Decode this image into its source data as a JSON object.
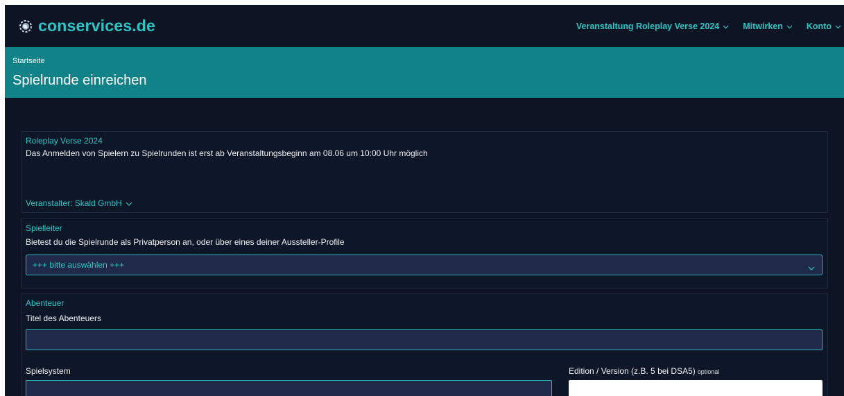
{
  "brand": {
    "name": "conservices.de",
    "logo_icon": "globe-gear-icon"
  },
  "nav": {
    "items": [
      {
        "label": "Veranstaltung Roleplay Verse 2024"
      },
      {
        "label": "Mitwirken"
      },
      {
        "label": "Konto"
      }
    ]
  },
  "hero": {
    "breadcrumb": "Startseite",
    "title": "Spielrunde einreichen"
  },
  "event": {
    "title": "Roleplay Verse 2024",
    "notice": "Das Anmelden von Spielern zu Spielrunden ist erst ab Veranstaltungsbeginn am 08.06 um 10:00 Uhr möglich",
    "organizer": "Veranstalter: Skald GmbH"
  },
  "gm": {
    "title": "Spielleiter",
    "question": "Bietest du die Spielrunde als Privatperson an, oder über eines deiner Aussteller-Profile",
    "select_value": "+++ bitte auswählen +++"
  },
  "adventure": {
    "title": "Abenteuer",
    "title_label": "Titel des Abenteuers",
    "system_label": "Spielsystem",
    "edition_label": "Edition / Version (z.B. 5 bei DSA5)",
    "optional_label": "optional"
  },
  "colors": {
    "accent": "#2cc5c5",
    "hero": "#118287",
    "background": "#0d1524",
    "field": "#1e2a47"
  }
}
